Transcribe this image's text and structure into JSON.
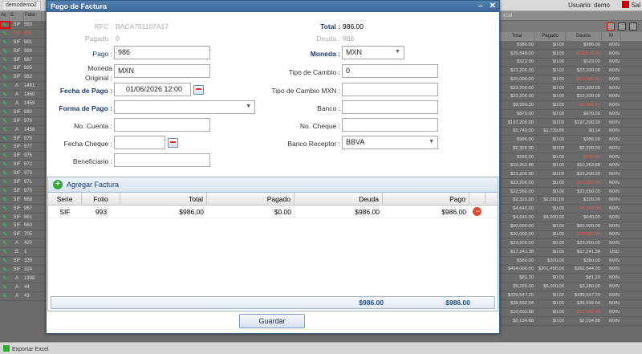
{
  "background": {
    "tab": "demodemo2",
    "user": "Usuario: demo",
    "logout": "Sal",
    "bottom_button": "Exportar Excel",
    "search_placeholder": "scal",
    "left_headers": [
      "Ac",
      "S",
      "Folio"
    ],
    "left_rows": [
      {
        "s": "SIF",
        "f": "993"
      },
      {
        "s": "SIF",
        "f": "992"
      },
      {
        "s": "SIF",
        "f": "991"
      },
      {
        "s": "SIF",
        "f": "988"
      },
      {
        "s": "SIF",
        "f": "987"
      },
      {
        "s": "SIF",
        "f": "985"
      },
      {
        "s": "SIF",
        "f": "982"
      },
      {
        "s": "A",
        "f": "1461"
      },
      {
        "s": "A",
        "f": "1460"
      },
      {
        "s": "A",
        "f": "1459"
      },
      {
        "s": "SIF",
        "f": "980"
      },
      {
        "s": "SIF",
        "f": "978"
      },
      {
        "s": "A",
        "f": "1458"
      },
      {
        "s": "SIF",
        "f": "979"
      },
      {
        "s": "SIF",
        "f": "977"
      },
      {
        "s": "SIF",
        "f": "976"
      },
      {
        "s": "SIF",
        "f": "972"
      },
      {
        "s": "SIF",
        "f": "973"
      },
      {
        "s": "SIF",
        "f": "971"
      },
      {
        "s": "SIF",
        "f": "970"
      },
      {
        "s": "SIF",
        "f": "968"
      },
      {
        "s": "SIF",
        "f": "967"
      },
      {
        "s": "SIF",
        "f": "961"
      },
      {
        "s": "SIF",
        "f": "960"
      },
      {
        "s": "SIF",
        "f": "705"
      },
      {
        "s": "A",
        "f": "420"
      },
      {
        "s": "B",
        "f": "1"
      },
      {
        "s": "SIF",
        "f": "339"
      },
      {
        "s": "SIF",
        "f": "324"
      },
      {
        "s": "A",
        "f": "1398"
      },
      {
        "s": "A",
        "f": "44"
      },
      {
        "s": "A",
        "f": "43"
      }
    ],
    "right_headers": [
      "Total",
      "Pagado",
      "Deuda",
      "M"
    ],
    "right_rows": [
      {
        "t": "$986.00",
        "p": "$0.00",
        "d": "$986.00",
        "m": "MXN"
      },
      {
        "t": "$25,848.00",
        "p": "$0.00",
        "d": "$25,848.00",
        "m": "MXN"
      },
      {
        "t": "$522.00",
        "p": "$0.00",
        "d": "$522.00",
        "m": "MXN"
      },
      {
        "t": "$23,200.00",
        "p": "$0.00",
        "d": "$23,200.00",
        "m": "MXN"
      },
      {
        "t": "$20,000.00",
        "p": "$0.00",
        "d": "$20,000.00",
        "m": "MXN"
      },
      {
        "t": "$23,200.00",
        "p": "$0.00",
        "d": "$23,200.00",
        "m": "MXN"
      },
      {
        "t": "$23,200.00",
        "p": "$0.00",
        "d": "$13,200.00",
        "m": "MXN"
      },
      {
        "t": "$9,999.20",
        "p": "$0.00",
        "d": "$9,999.20",
        "m": "MXN"
      },
      {
        "t": "$870.00",
        "p": "$0.00",
        "d": "$870.00",
        "m": "MXN"
      },
      {
        "t": "$197,200.00",
        "p": "$0.00",
        "d": "$197,200.00",
        "m": "MXN"
      },
      {
        "t": "$1,740.00",
        "p": "$1,739.86",
        "d": "$0.14",
        "m": "MXN"
      },
      {
        "t": "$986.00",
        "p": "$0.00",
        "d": "$986.00",
        "m": "MXN"
      },
      {
        "t": "$2,320.00",
        "p": "$0.00",
        "d": "$2,320.00",
        "m": "MXN"
      },
      {
        "t": "$290.00",
        "p": "$0.00",
        "d": "$290.00",
        "m": "MXN"
      },
      {
        "t": "$10,263.88",
        "p": "$0.00",
        "d": "$10,263.88",
        "m": "MXN"
      },
      {
        "t": "$23,200.00",
        "p": "$0.00",
        "d": "$23,200.00",
        "m": "MXN"
      },
      {
        "t": "$23,200.00",
        "p": "$0.00",
        "d": "$23,200.00",
        "m": "MXN"
      },
      {
        "t": "$22,950.00",
        "p": "$0.00",
        "d": "$22,950.00",
        "m": "MXN"
      },
      {
        "t": "$2,320.00",
        "p": "$2,000.00",
        "d": "$320.00",
        "m": "MXN"
      },
      {
        "t": "$4,640.00",
        "p": "$0.00",
        "d": "$4,640.00",
        "m": "MXN"
      },
      {
        "t": "$4,640.00",
        "p": "$4,000.00",
        "d": "$640.00",
        "m": "MXN"
      },
      {
        "t": "$60,000.00",
        "p": "$0.00",
        "d": "$60,000.00",
        "m": "MXN"
      },
      {
        "t": "$30,000.00",
        "p": "$0.00",
        "d": "$30,000.00",
        "m": "MXN"
      },
      {
        "t": "$23,200.00",
        "p": "$0.00",
        "d": "$23,200.00",
        "m": "MXN"
      },
      {
        "t": "$17,241.38",
        "p": "$0.00",
        "d": "$17,241.38",
        "m": "USD"
      },
      {
        "t": "$580.00",
        "p": "$300.00",
        "d": "$280.00",
        "m": "MXN"
      },
      {
        "t": "$464,000.00",
        "p": "$201,456.00",
        "d": "$262,544.00",
        "m": "MXN"
      },
      {
        "t": "$81.20",
        "p": "$0.00",
        "d": "$81.20",
        "m": "MXN"
      },
      {
        "t": "$9,280.00",
        "p": "$6,000.00",
        "d": "$3,280.00",
        "m": "MXN"
      },
      {
        "t": "$439,547.20",
        "p": "$0.00",
        "d": "$439,547.20",
        "m": "MXN"
      },
      {
        "t": "$36,592.04",
        "p": "$0.00",
        "d": "$36,592.04",
        "m": "MXN"
      },
      {
        "t": "$10,692.88",
        "p": "$0.00",
        "d": "$10,692.88",
        "m": "MXN"
      },
      {
        "t": "$2,134.88",
        "p": "$0.00",
        "d": "$2,134.88",
        "m": "MXN"
      }
    ]
  },
  "dialog": {
    "title": "Pago de Factura",
    "minimize": "–",
    "close": "✕",
    "rfc_label": "RFC :",
    "rfc_value": "BACA701107A17",
    "pagado_label": "Pagado :",
    "pagado_value": "0",
    "total_label": "Total :",
    "total_value": "986.00",
    "deuda_label": "Deuda :",
    "deuda_value": "986",
    "pago_label": "Pago :",
    "pago_value": "986",
    "moneda_label": "Moneda :",
    "moneda_value": "MXN",
    "moneda_original_label": "Moneda Original :",
    "moneda_original_value": "MXN",
    "tipo_cambio_label": "Tipo de Cambio :",
    "tipo_cambio_value": "0",
    "fecha_pago_label": "Fecha de Pago :",
    "fecha_pago_value": "01/06/2026 12:00",
    "tipo_cambio_mxn_label": "Tipo de Cambio MXN :",
    "tipo_cambio_mxn_value": "",
    "forma_pago_label": "Forma de Pago :",
    "forma_pago_value": "",
    "banco_label": "Banco :",
    "banco_value": "",
    "no_cuenta_label": "No. Cuenta :",
    "no_cuenta_value": "",
    "no_cheque_label": "No. Cheque :",
    "no_cheque_value": "",
    "fecha_cheque_label": "Fecha Cheque :",
    "fecha_cheque_value": "",
    "banco_receptor_label": "Banco Receptor :",
    "banco_receptor_value": "BBVA",
    "beneficiario_label": "Beneficiario :",
    "beneficiario_value": "",
    "add_invoice_label": "Agregar Factura",
    "table_headers": [
      "Serie",
      "Folio",
      "Total",
      "Pagado",
      "Deuda",
      "Pago"
    ],
    "table_rows": [
      {
        "serie": "SIF",
        "folio": "993",
        "total": "$986.00",
        "pagado": "$0.00",
        "deuda": "$986.00",
        "pago": "$986.00"
      }
    ],
    "footer_deuda": "$986.00",
    "footer_pago": "$986.00",
    "save_label": "Guardar"
  }
}
